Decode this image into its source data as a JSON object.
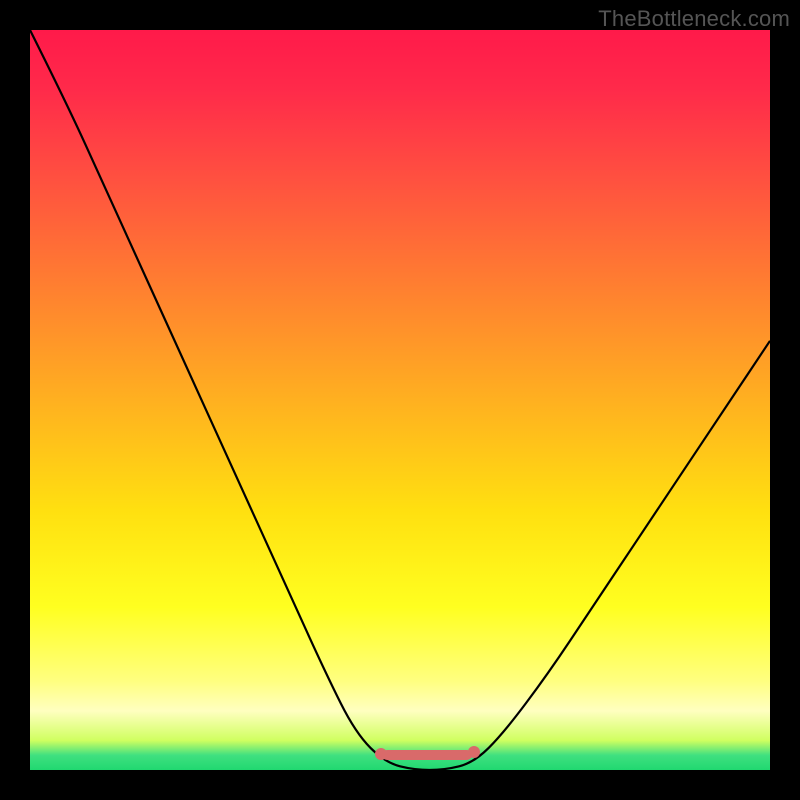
{
  "watermark": "TheBottleneck.com",
  "chart_data": {
    "type": "line",
    "title": "",
    "xlabel": "",
    "ylabel": "",
    "xlim": [
      0,
      100
    ],
    "ylim": [
      0,
      100
    ],
    "grid": false,
    "series": [
      {
        "name": "bottleneck-curve",
        "x": [
          0,
          5,
          10,
          15,
          20,
          25,
          30,
          35,
          40,
          44,
          48,
          52,
          56,
          60,
          64,
          70,
          76,
          82,
          88,
          94,
          100
        ],
        "y": [
          100,
          90,
          79,
          68,
          57,
          46,
          35,
          24,
          13,
          5,
          1,
          0,
          0,
          1,
          5,
          13,
          22,
          31,
          40,
          49,
          58
        ]
      }
    ],
    "minimum_region": {
      "x_start": 48,
      "x_end": 60,
      "y": 0
    },
    "background_gradient": {
      "top": "#ff1a4a",
      "mid": "#ffe010",
      "bottom": "#20d870"
    }
  }
}
